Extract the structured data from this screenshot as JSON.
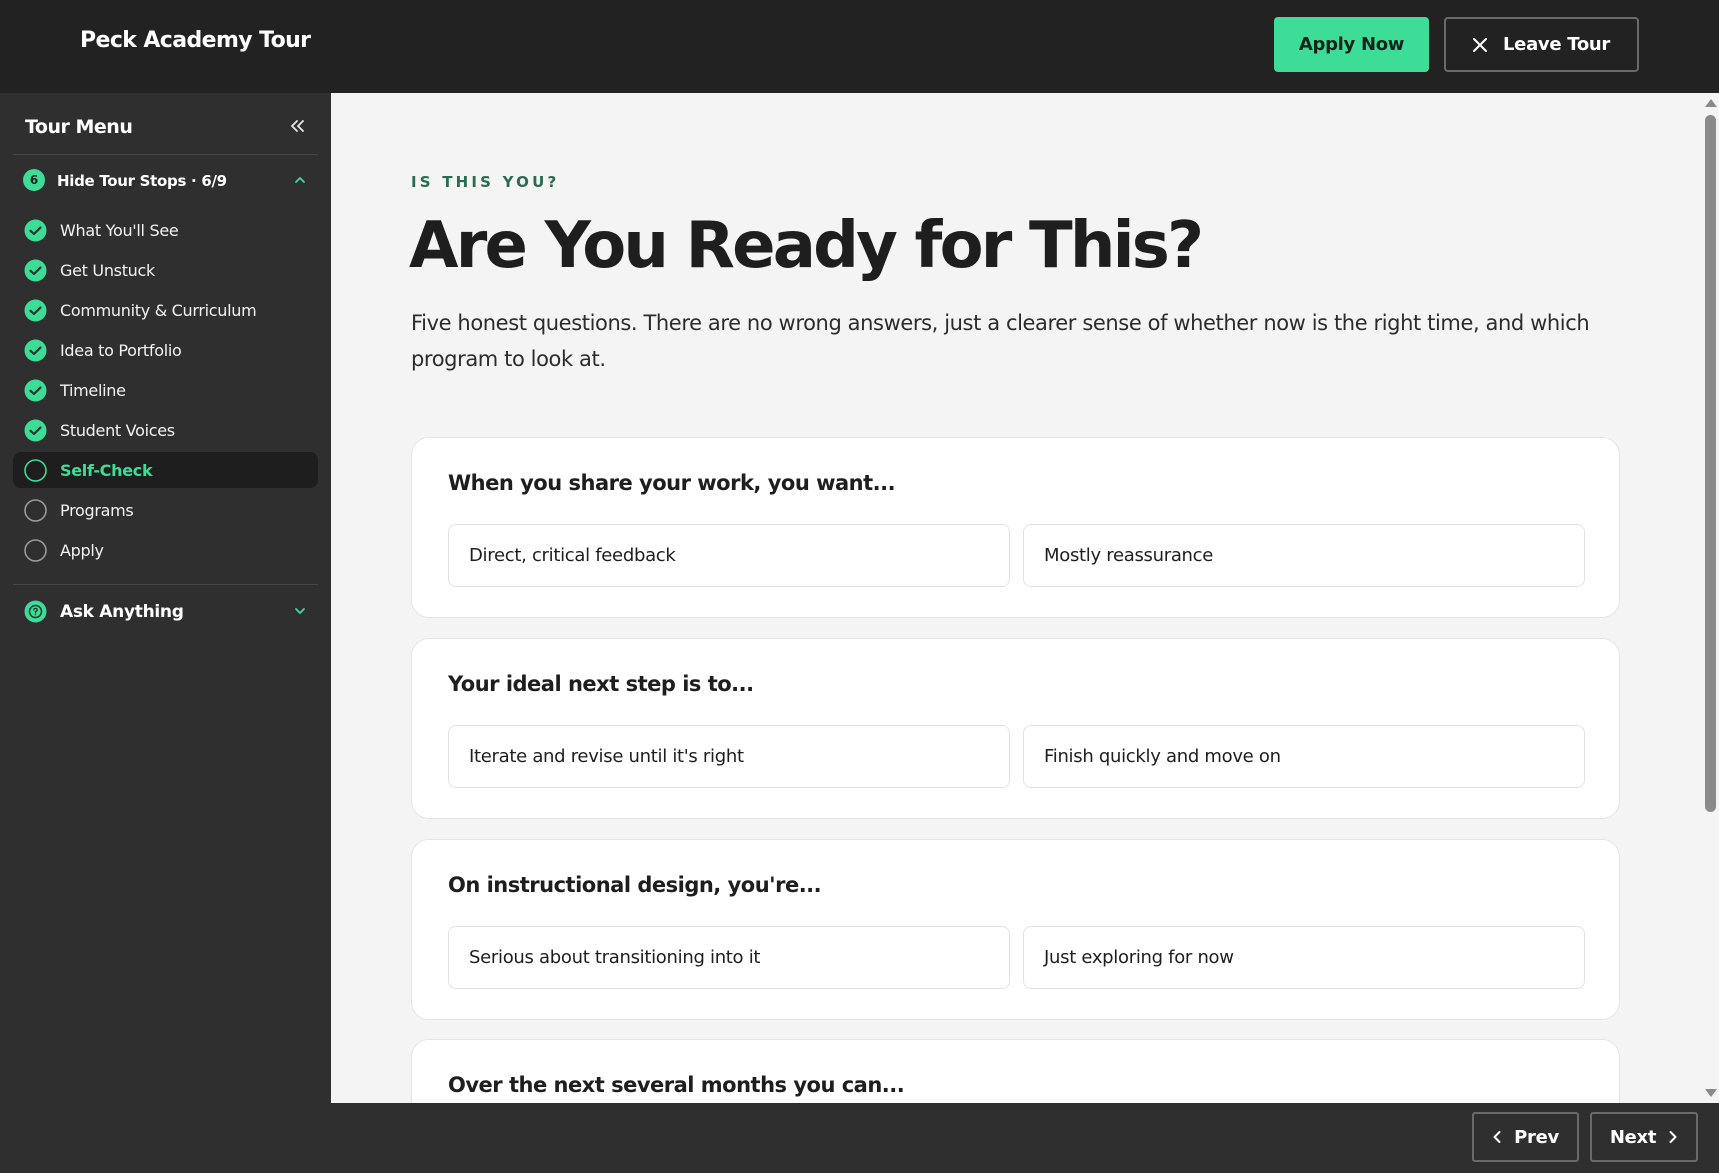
{
  "header": {
    "brand": "Peck Academy Tour",
    "apply_label": "Apply Now",
    "leave_label": "Leave Tour"
  },
  "sidebar": {
    "title": "Tour Menu",
    "stops_toggle": {
      "badge": "6",
      "label": "Hide Tour Stops · 6/9"
    },
    "stops": [
      {
        "label": "What You'll See",
        "status": "done"
      },
      {
        "label": "Get Unstuck",
        "status": "done"
      },
      {
        "label": "Community & Curriculum",
        "status": "done"
      },
      {
        "label": "Idea to Portfolio",
        "status": "done"
      },
      {
        "label": "Timeline",
        "status": "done"
      },
      {
        "label": "Student Voices",
        "status": "done"
      },
      {
        "label": "Self-Check",
        "status": "current"
      },
      {
        "label": "Programs",
        "status": "todo"
      },
      {
        "label": "Apply",
        "status": "todo"
      }
    ],
    "ask_label": "Ask Anything"
  },
  "main": {
    "eyebrow": "IS THIS YOU?",
    "title": "Are You Ready for This?",
    "intro": "Five honest questions. There are no wrong answers, just a clearer sense of whether now is the right time, and which program to look at.",
    "questions": [
      {
        "prompt": "When you share your work, you want...",
        "options": [
          "Direct, critical feedback",
          "Mostly reassurance"
        ]
      },
      {
        "prompt": "Your ideal next step is to...",
        "options": [
          "Iterate and revise until it's right",
          "Finish quickly and move on"
        ]
      },
      {
        "prompt": "On instructional design, you're...",
        "options": [
          "Serious about transitioning into it",
          "Just exploring for now"
        ]
      },
      {
        "prompt": "Over the next several months you can...",
        "options": [
          "",
          ""
        ]
      }
    ]
  },
  "footer": {
    "prev_label": "Prev",
    "next_label": "Next"
  },
  "colors": {
    "accent": "#3ddc97",
    "topbar": "#222222",
    "sidebar": "#2f2f2f",
    "page_bg": "#f3f4f3",
    "eyebrow": "#2b6b52"
  },
  "icons": {
    "close": "close-icon",
    "collapse": "double-chevron-left-icon",
    "done": "check-circle-icon",
    "todo": "empty-circle-icon",
    "ask": "question-circle-icon",
    "prev": "chevron-left-icon",
    "next": "chevron-right-icon"
  }
}
